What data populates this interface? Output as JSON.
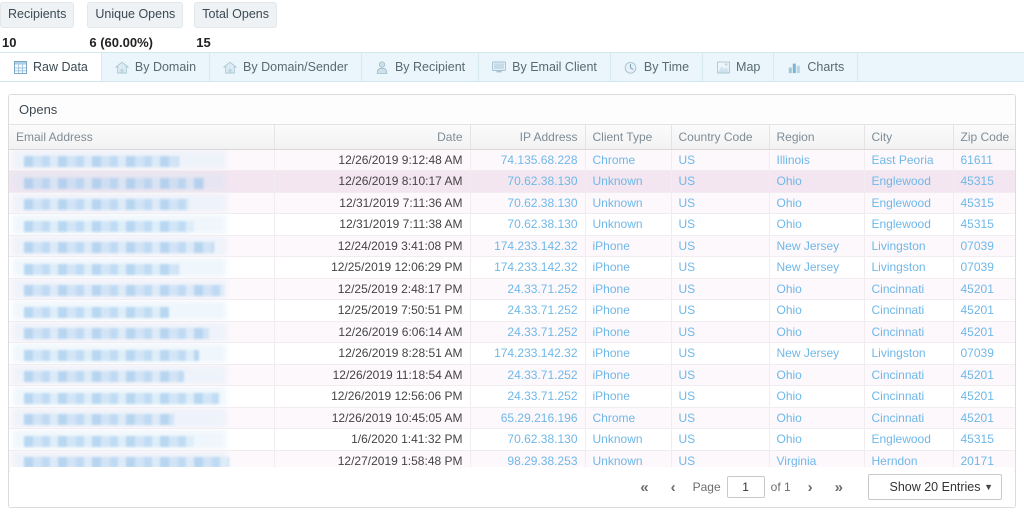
{
  "stats": [
    {
      "label": "Recipients",
      "value": "10"
    },
    {
      "label": "Unique Opens",
      "value": "6 (60.00%)"
    },
    {
      "label": "Total Opens",
      "value": "15"
    }
  ],
  "tabs": [
    {
      "label": "Raw Data",
      "icon": "table-icon",
      "active": true
    },
    {
      "label": "By Domain",
      "icon": "home-icon",
      "active": false
    },
    {
      "label": "By Domain/Sender",
      "icon": "home-icon",
      "active": false
    },
    {
      "label": "By Recipient",
      "icon": "person-icon",
      "active": false
    },
    {
      "label": "By Email Client",
      "icon": "monitor-icon",
      "active": false
    },
    {
      "label": "By Time",
      "icon": "clock-icon",
      "active": false
    },
    {
      "label": "Map",
      "icon": "map-icon",
      "active": false
    },
    {
      "label": "Charts",
      "icon": "bar-chart-icon",
      "active": false
    }
  ],
  "panel": {
    "title": "Opens",
    "columns": [
      {
        "label": "Email Address",
        "align": "left"
      },
      {
        "label": "Date",
        "align": "right"
      },
      {
        "label": "IP Address",
        "align": "right"
      },
      {
        "label": "Client Type",
        "align": "left"
      },
      {
        "label": "Country Code",
        "align": "left"
      },
      {
        "label": "Region",
        "align": "left"
      },
      {
        "label": "City",
        "align": "left"
      },
      {
        "label": "Zip Code",
        "align": "left"
      }
    ],
    "rows": [
      {
        "email": "",
        "date": "12/26/2019 9:12:48 AM",
        "ip": "74.135.68.228",
        "client": "Chrome",
        "country": "US",
        "region": "Illinois",
        "city": "East Peoria",
        "zip": "61611"
      },
      {
        "email": "",
        "date": "12/26/2019 8:10:17 AM",
        "ip": "70.62.38.130",
        "client": "Unknown",
        "country": "US",
        "region": "Ohio",
        "city": "Englewood",
        "zip": "45315"
      },
      {
        "email": "",
        "date": "12/31/2019 7:11:36 AM",
        "ip": "70.62.38.130",
        "client": "Unknown",
        "country": "US",
        "region": "Ohio",
        "city": "Englewood",
        "zip": "45315"
      },
      {
        "email": "",
        "date": "12/31/2019 7:11:38 AM",
        "ip": "70.62.38.130",
        "client": "Unknown",
        "country": "US",
        "region": "Ohio",
        "city": "Englewood",
        "zip": "45315"
      },
      {
        "email": "",
        "date": "12/24/2019 3:41:08 PM",
        "ip": "174.233.142.32",
        "client": "iPhone",
        "country": "US",
        "region": "New Jersey",
        "city": "Livingston",
        "zip": "07039"
      },
      {
        "email": "",
        "date": "12/25/2019 12:06:29 PM",
        "ip": "174.233.142.32",
        "client": "iPhone",
        "country": "US",
        "region": "New Jersey",
        "city": "Livingston",
        "zip": "07039"
      },
      {
        "email": "",
        "date": "12/25/2019 2:48:17 PM",
        "ip": "24.33.71.252",
        "client": "iPhone",
        "country": "US",
        "region": "Ohio",
        "city": "Cincinnati",
        "zip": "45201"
      },
      {
        "email": "",
        "date": "12/25/2019 7:50:51 PM",
        "ip": "24.33.71.252",
        "client": "iPhone",
        "country": "US",
        "region": "Ohio",
        "city": "Cincinnati",
        "zip": "45201"
      },
      {
        "email": "",
        "date": "12/26/2019 6:06:14 AM",
        "ip": "24.33.71.252",
        "client": "iPhone",
        "country": "US",
        "region": "Ohio",
        "city": "Cincinnati",
        "zip": "45201"
      },
      {
        "email": "",
        "date": "12/26/2019 8:28:51 AM",
        "ip": "174.233.142.32",
        "client": "iPhone",
        "country": "US",
        "region": "New Jersey",
        "city": "Livingston",
        "zip": "07039"
      },
      {
        "email": "",
        "date": "12/26/2019 11:18:54 AM",
        "ip": "24.33.71.252",
        "client": "iPhone",
        "country": "US",
        "region": "Ohio",
        "city": "Cincinnati",
        "zip": "45201"
      },
      {
        "email": "",
        "date": "12/26/2019 12:56:06 PM",
        "ip": "24.33.71.252",
        "client": "iPhone",
        "country": "US",
        "region": "Ohio",
        "city": "Cincinnati",
        "zip": "45201"
      },
      {
        "email": "",
        "date": "12/26/2019 10:45:05 AM",
        "ip": "65.29.216.196",
        "client": "Chrome",
        "country": "US",
        "region": "Ohio",
        "city": "Cincinnati",
        "zip": "45201"
      },
      {
        "email": "",
        "date": "1/6/2020 1:41:32 PM",
        "ip": "70.62.38.130",
        "client": "Unknown",
        "country": "US",
        "region": "Ohio",
        "city": "Englewood",
        "zip": "45315"
      },
      {
        "email": "",
        "date": "12/27/2019 1:58:48 PM",
        "ip": "98.29.38.253",
        "client": "Unknown",
        "country": "US",
        "region": "Virginia",
        "city": "Herndon",
        "zip": "20171"
      }
    ]
  },
  "pagination": {
    "first_icon": "«",
    "prev_icon": "‹",
    "page_label": "Page",
    "page_value": "1",
    "of_label": "of 1",
    "next_icon": "›",
    "last_icon": "»",
    "entries_label": "Show 20 Entries",
    "caret_icon": "▼"
  },
  "colors": {
    "link": "#6fb8e8",
    "tab_bar_bg": "#eaf6fb",
    "row_alt": "#fcf8fc",
    "row_hover": "#f3e6f0"
  }
}
